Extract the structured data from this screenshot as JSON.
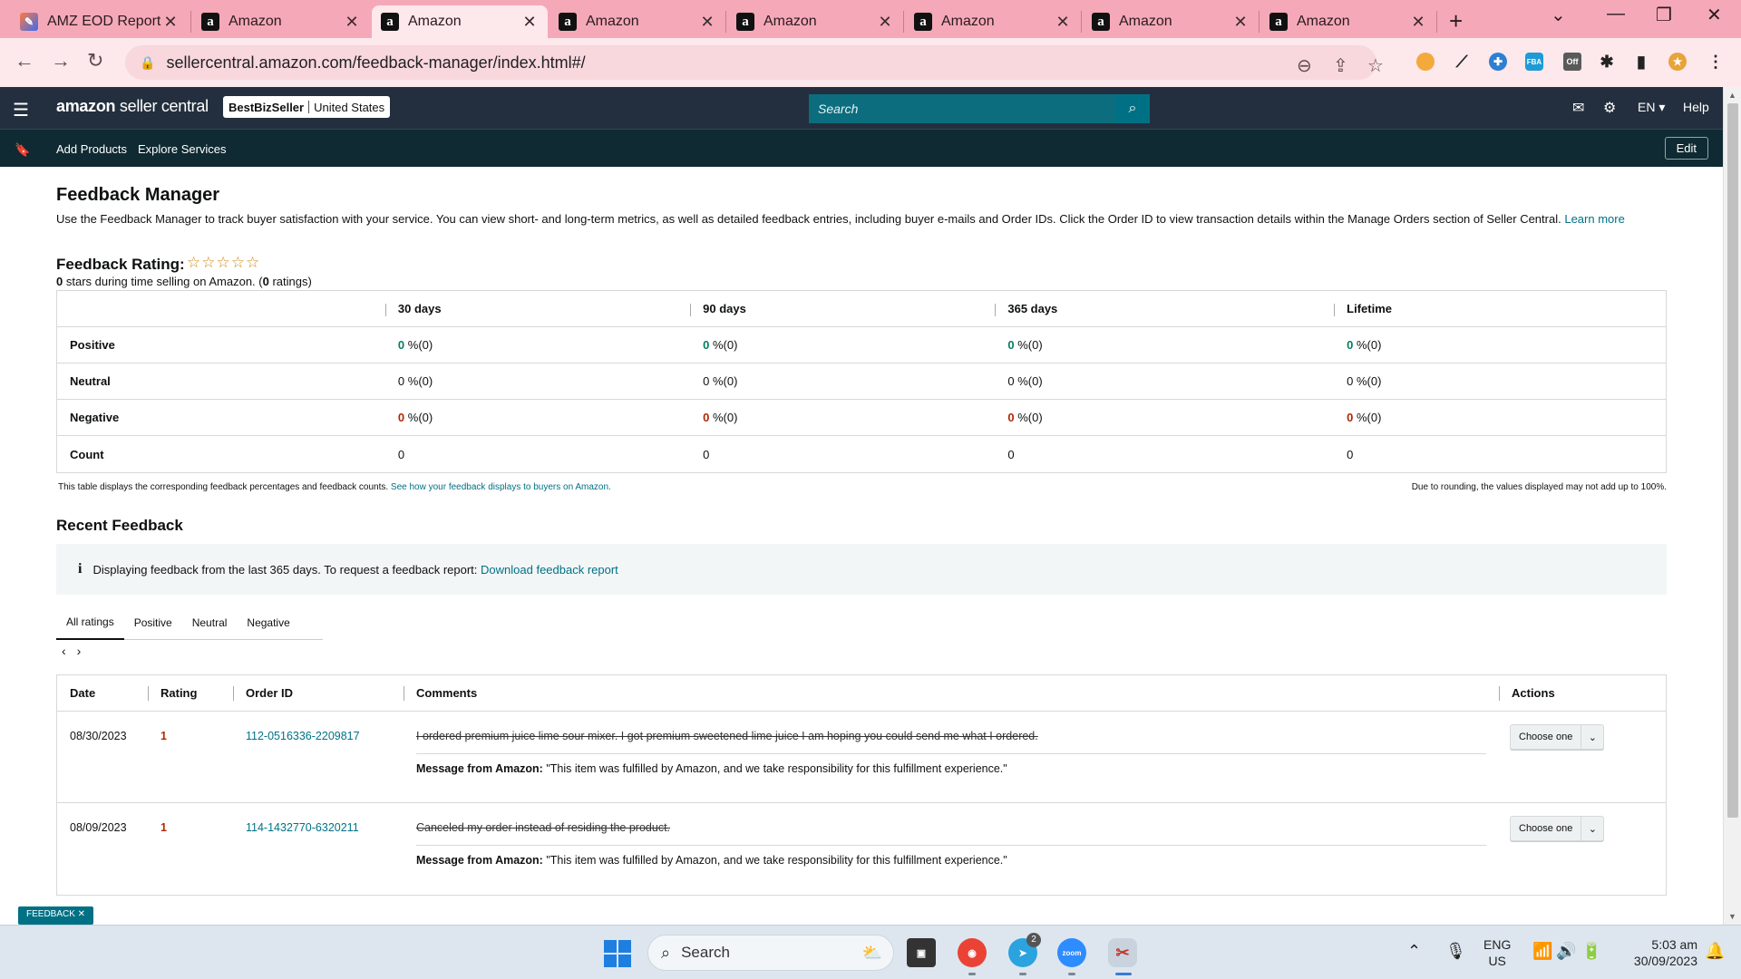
{
  "browser": {
    "tabs": [
      {
        "title": "AMZ EOD Report",
        "favicon": "edu-icon"
      },
      {
        "title": "Amazon",
        "favicon": "a"
      },
      {
        "title": "Amazon",
        "favicon": "a",
        "active": true
      },
      {
        "title": "Amazon",
        "favicon": "a"
      },
      {
        "title": "Amazon",
        "favicon": "a"
      },
      {
        "title": "Amazon",
        "favicon": "a"
      },
      {
        "title": "Amazon",
        "favicon": "a"
      },
      {
        "title": "Amazon",
        "favicon": "a"
      }
    ],
    "url": "sellercentral.amazon.com/feedback-manager/index.html#/",
    "tab_close": "✕",
    "new_tab": "+",
    "ext_off_label": "Off"
  },
  "sc_header": {
    "logo_amazon": "amazon",
    "logo_rest": "seller central",
    "account_name": "BestBizSeller",
    "account_region": "United States",
    "search_placeholder": "Search",
    "lang": "EN",
    "help": "Help",
    "nav_items": [
      "Add Products",
      "Explore Services"
    ],
    "edit": "Edit"
  },
  "page": {
    "title": "Feedback Manager",
    "intro": "Use the Feedback Manager to track buyer satisfaction with your service. You can view short- and long-term metrics, as well as detailed feedback entries, including buyer e-mails and Order IDs. Click the Order ID to view transaction details within the Manage Orders section of Seller Central.",
    "learn_more": "Learn more",
    "rating_title": "Feedback Rating:",
    "rating_stars": "☆☆☆☆☆",
    "rating_value": "0",
    "rating_sub_mid": " stars during time selling on Amazon. (",
    "rating_count": "0",
    "rating_sub_end": " ratings)",
    "table_headers": [
      "30 days",
      "90 days",
      "365 days",
      "Lifetime"
    ],
    "rows": [
      {
        "label": "Positive",
        "cells": [
          "0",
          "0",
          "0",
          "0"
        ],
        "suffix": " %(0)",
        "color": "#067d62"
      },
      {
        "label": "Neutral",
        "cells": [
          "0",
          "0",
          "0",
          "0"
        ],
        "suffix": " %(0)",
        "color": "#0f1111"
      },
      {
        "label": "Negative",
        "cells": [
          "0",
          "0",
          "0",
          "0"
        ],
        "suffix": " %(0)",
        "color": "#b12704"
      },
      {
        "label": "Count",
        "cells": [
          "0",
          "0",
          "0",
          "0"
        ],
        "suffix": "",
        "color": "#0f1111"
      }
    ],
    "table_note": "This table displays the corresponding feedback percentages and feedback counts.",
    "table_note_link": "See how your feedback displays to buyers on Amazon.",
    "rounding_note": "Due to rounding, the values displayed may not add up to 100%.",
    "recent_title": "Recent Feedback",
    "info_text": "Displaying feedback from the last 365 days. To request a feedback report:",
    "info_link": "Download feedback report",
    "tabs": [
      "All ratings",
      "Positive",
      "Neutral",
      "Negative"
    ],
    "pager_prev": "‹",
    "pager_next": "›",
    "feedback_headers": {
      "date": "Date",
      "rating": "Rating",
      "order": "Order ID",
      "comments": "Comments",
      "actions": "Actions"
    },
    "feedback": [
      {
        "date": "08/30/2023",
        "rating": "1",
        "order_id": "112-0516336-2209817",
        "comment": "I ordered premium juice lime sour mixer. I got premium sweetened lime juice I am hoping you could send me what I ordered.",
        "message_label": "Message from Amazon:",
        "message": " \"This item was fulfilled by Amazon, and we take responsibility for this fulfillment experience.\"",
        "action": "Choose one"
      },
      {
        "date": "08/09/2023",
        "rating": "1",
        "order_id": "114-1432770-6320211",
        "comment": "Canceled my order instead of residing the product.",
        "message_label": "Message from Amazon:",
        "message": " \"This item was fulfilled by Amazon, and we take responsibility for this fulfillment experience.\"",
        "action": "Choose one"
      }
    ],
    "feedback_badge": "FEEDBACK ✕"
  },
  "taskbar": {
    "search": "Search",
    "telegram_badge": "2",
    "zoom_label": "zoom",
    "lang_top": "ENG",
    "lang_bottom": "US",
    "time": "5:03 am",
    "date": "30/09/2023"
  }
}
